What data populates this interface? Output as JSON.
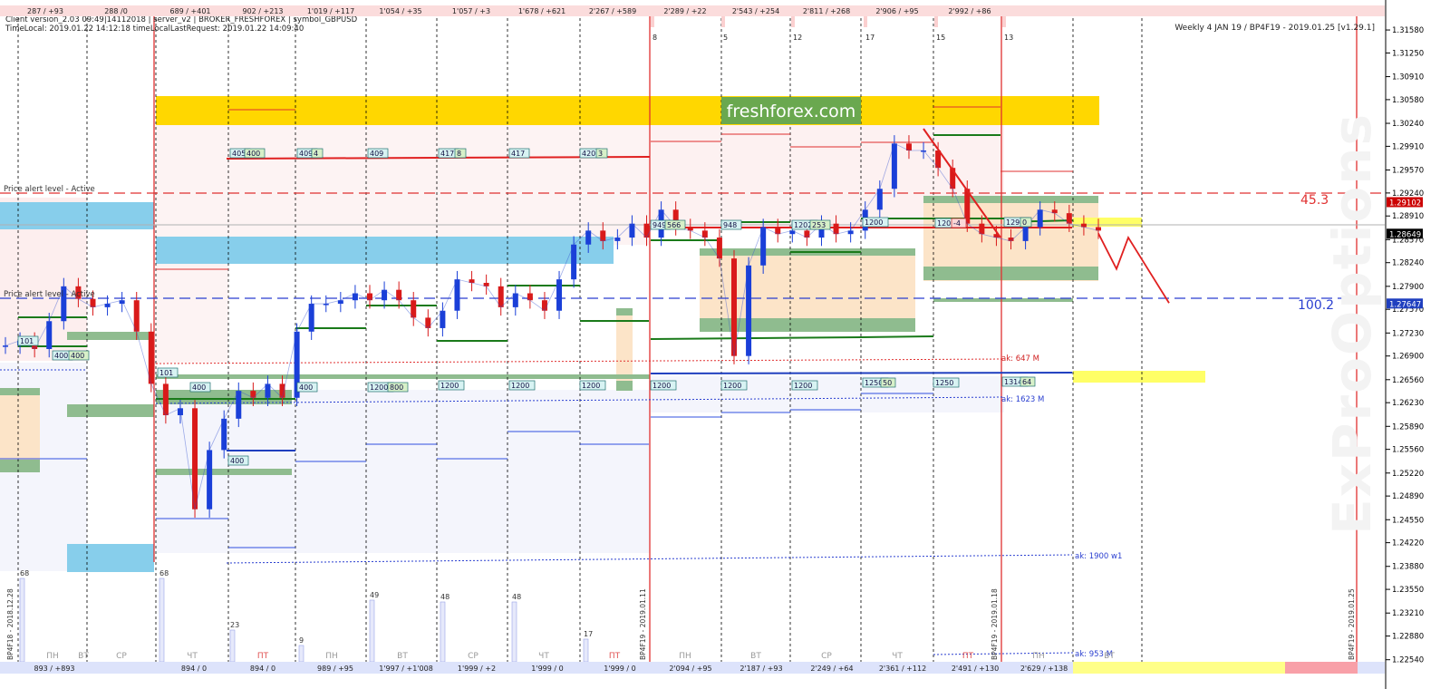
{
  "header": {
    "line1": "Client version_2.03 09:49|14112018 | server_v2 | BROKER_FRESHFOREX | symbol_GBPUSD",
    "line2": "TimeLocal: 2019.01.22 14:12:18 timeLocalLastRequest: 2019.01.22 14:09:40",
    "right_title": "Weekly 4 JAN 19 / BP4F19 - 2019.01.25 [v1.29.1]"
  },
  "logo": {
    "text": "freshforex.com",
    "bg": "#6aa84f"
  },
  "watermark": "ExProOptions",
  "colors": {
    "bull": "#1a3fd8",
    "bear": "#d91a1a",
    "zone_gold": "#ffd700",
    "zone_blue": "#87ceeb",
    "zone_green": "#8fbc8f",
    "zone_peach": "#fce4c8",
    "zone_pink": "#fdeeee",
    "zone_lav": "#f1f3fb",
    "yellow": "#ffff66"
  },
  "price_axis": {
    "ticks": [
      "1.31580",
      "1.31250",
      "1.30910",
      "1.30580",
      "1.30240",
      "1.29910",
      "1.29570",
      "1.29240",
      "1.28910",
      "1.28570",
      "1.28240",
      "1.27900",
      "1.27570",
      "1.27230",
      "1.26900",
      "1.26560",
      "1.26230",
      "1.25890",
      "1.25560",
      "1.25220",
      "1.24890",
      "1.24550",
      "1.24220",
      "1.23880",
      "1.23550",
      "1.23210",
      "1.22880",
      "1.22540"
    ],
    "badges": [
      {
        "text": "1.29102",
        "color": "#cc0000"
      },
      {
        "text": "1.28649",
        "color": "#000000"
      },
      {
        "text": "1.27647",
        "color": "#1f3fbf"
      }
    ]
  },
  "top_strip": [
    "287 / +93",
    "288 /0",
    "689 / +401",
    "902 / +213",
    "1'019 / +117",
    "1'054 / +35",
    "1'057 / +3",
    "1'678 / +621",
    "2'267 / +589",
    "2'289 / +22",
    "2'543 / +254",
    "2'811 / +268",
    "2'906 / +95",
    "2'992 / +86"
  ],
  "top_markers": [
    "8",
    "5",
    "12",
    "17",
    "15",
    "13"
  ],
  "bottom_strip": [
    "893 / +893",
    "894 / 0",
    "894 / 0",
    "989 / +95",
    "1'997 / +1'008",
    "1'999 / +2",
    "1'999 / 0",
    "1'999 / 0",
    "2'094 / +95",
    "2'187 / +93",
    "2'249 / +64",
    "2'361 / +112",
    "2'491 / +130",
    "2'629 / +138"
  ],
  "day_labels": [
    "ПН",
    "ВТ",
    "СР",
    "ЧТ",
    "ПТ",
    "ПН",
    "ВТ",
    "СР",
    "ЧТ",
    "ПТ",
    "ПН",
    "ВТ",
    "СР",
    "ЧТ",
    "ПТ",
    "ПН",
    "ВТ"
  ],
  "week_labels": [
    "BP4F18 - 2018.12.28",
    "BP4F19 - 2019.01.11",
    "BP4F19 - 2019.01.18",
    "BP4F19 - 2019.01.25"
  ],
  "volume_labels": [
    "68",
    "68",
    "23",
    "9",
    "49",
    "48",
    "48",
    "17"
  ],
  "alerts": [
    "Price alert level - Active",
    "Price alert level - Active"
  ],
  "level_numbers": [
    "45.3",
    "100.2"
  ],
  "annotations": [
    "ak: 647 M",
    "ak: 1623 M",
    "ak: 1900 w1",
    "ak: 953 M"
  ],
  "boxes": [
    "405",
    "400",
    "409",
    "4",
    "409",
    "417",
    "8",
    "417",
    "420",
    "3",
    "949",
    "566",
    "948",
    "1202",
    "253",
    "1200",
    "1202",
    "-4",
    "1294",
    "0",
    "101",
    "400",
    "400",
    "101",
    "400",
    "400",
    "1200",
    "800",
    "1200",
    "1200",
    "1200",
    "1200",
    "1200",
    "1200",
    "1250",
    "50",
    "1250",
    "1314",
    "64",
    "400"
  ],
  "chart_data": {
    "type": "line",
    "title": "Weekly 4 JAN 19 / BP4F19 - 2019.01.25 [v1.29.1]",
    "xlabel": "",
    "ylabel": "",
    "ylim": [
      1.2238,
      1.3175
    ],
    "x": [
      0,
      1,
      2,
      3,
      4,
      5,
      6,
      7,
      8,
      9,
      10,
      11,
      12,
      13,
      14,
      15,
      16,
      17,
      18,
      19,
      20,
      21,
      22,
      23,
      24,
      25,
      26,
      27,
      28,
      29,
      30,
      31,
      32,
      33,
      34,
      35,
      36,
      37,
      38,
      39,
      40,
      41,
      42,
      43,
      44,
      45,
      46,
      47,
      48,
      49,
      50,
      51,
      52,
      53,
      54,
      55,
      56,
      57,
      58,
      59,
      60,
      61,
      62,
      63,
      64,
      65,
      66,
      67,
      68,
      69,
      70,
      71,
      72,
      73,
      74,
      75,
      76,
      77,
      78,
      79,
      80
    ],
    "series": [
      {
        "values": [
          1.2705,
          1.2712,
          1.27,
          1.274,
          1.279,
          1.2772,
          1.276,
          1.2765,
          1.277,
          1.2725,
          1.265,
          1.2605,
          1.2615,
          1.247,
          1.2555,
          1.26,
          1.264,
          1.263,
          1.265,
          1.263,
          1.2725,
          1.2765,
          1.2765,
          1.277,
          1.278,
          1.277,
          1.2785,
          1.277,
          1.2745,
          1.273,
          1.2755,
          1.28,
          1.2795,
          1.279,
          1.276,
          1.278,
          1.277,
          1.2755,
          1.28,
          1.285,
          1.287,
          1.2855,
          1.286,
          1.288,
          1.286,
          1.29,
          1.2875,
          1.287,
          1.286,
          1.283,
          1.269,
          1.282,
          1.2875,
          1.2865,
          1.287,
          1.286,
          1.288,
          1.2865,
          1.287,
          1.29,
          1.293,
          1.2995,
          1.2985,
          1.2985,
          1.296,
          1.293,
          1.288,
          1.2865,
          1.286,
          1.2855,
          1.2875,
          1.29,
          1.2895,
          1.288,
          1.2875,
          1.287
        ]
      }
    ],
    "forecast": [
      1.2866,
      1.2815,
      1.286,
      1.2766
    ],
    "levels": [
      1.291,
      1.2865,
      1.2765
    ]
  }
}
